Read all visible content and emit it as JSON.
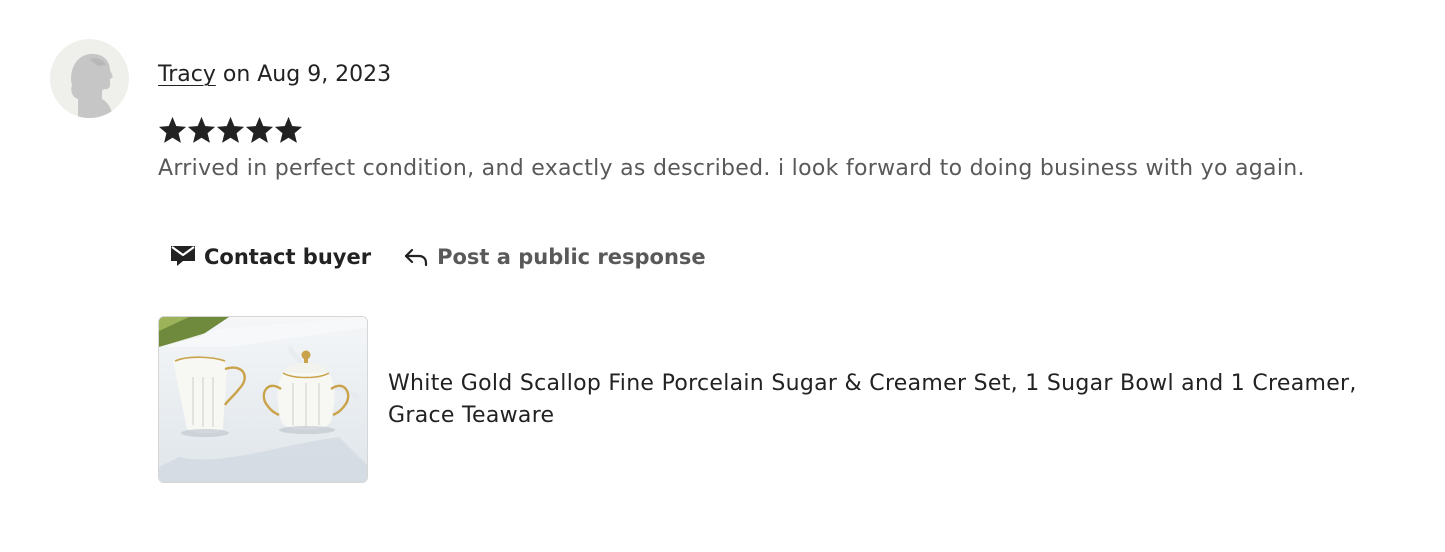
{
  "review": {
    "reviewer_name": "Tracy",
    "date_text": " on Aug 9, 2023",
    "rating": 5,
    "rating_max": 5,
    "text": "Arrived in perfect condition, and exactly as described. i look forward to doing business with yo again."
  },
  "actions": {
    "contact_label": "Contact buyer",
    "contact_icon": "envelope-icon",
    "respond_label": "Post a public response",
    "respond_icon": "reply-arrow-icon"
  },
  "product": {
    "title": "White Gold Scallop Fine Porcelain Sugar & Creamer Set, 1 Sugar Bowl and 1 Creamer, Grace Teaware"
  },
  "colors": {
    "text_primary": "#222222",
    "text_secondary": "#595959",
    "avatar_bg": "#efefeb",
    "star": "#222222"
  }
}
